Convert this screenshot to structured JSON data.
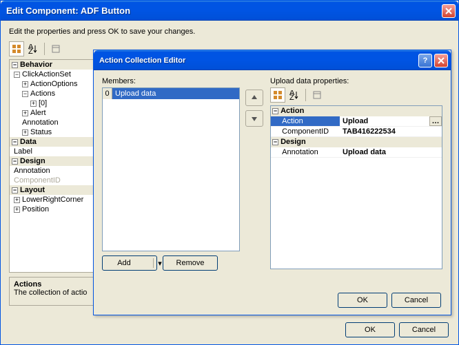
{
  "main": {
    "title": "Edit Component: ADF Button",
    "instruction": "Edit the properties and press OK to save your changes.",
    "ok": "OK",
    "cancel": "Cancel"
  },
  "tree": {
    "behavior": "Behavior",
    "clickActionSet": "ClickActionSet",
    "actionOptions": "ActionOptions",
    "actions": "Actions",
    "idx0": "[0]",
    "alert": "Alert",
    "annotation": "Annotation",
    "status": "Status",
    "data": "Data",
    "label": "Label",
    "design": "Design",
    "designAnnotation": "Annotation",
    "componentId": "ComponentID",
    "layout": "Layout",
    "lowerRightCorner": "LowerRightCorner",
    "position": "Position"
  },
  "desc": {
    "title": "Actions",
    "text": "The collection of actio"
  },
  "dlg": {
    "title": "Action Collection Editor",
    "membersLabel": "Members:",
    "propertiesLabel": "Upload data properties:",
    "add": "Add",
    "remove": "Remove",
    "ok": "OK",
    "cancel": "Cancel",
    "list": [
      {
        "index": "0",
        "label": "Upload data"
      }
    ],
    "grid": {
      "catAction": "Action",
      "actionKey": "Action",
      "actionVal": "Upload",
      "componentIdKey": "ComponentID",
      "componentIdVal": "TAB416222534",
      "catDesign": "Design",
      "annotationKey": "Annotation",
      "annotationVal": "Upload data"
    }
  }
}
